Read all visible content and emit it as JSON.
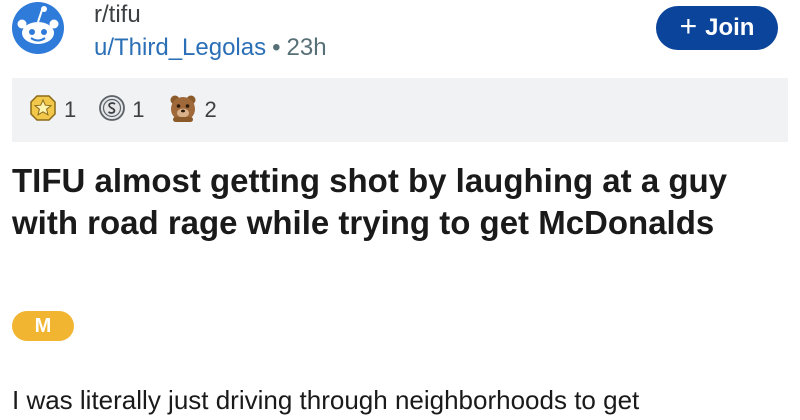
{
  "header": {
    "subreddit": "r/tifu",
    "username": "u/Third_Legolas",
    "separator": "•",
    "age": "23h",
    "join_label": "Join",
    "join_color": "#0a449b"
  },
  "awards": [
    {
      "icon": "star-award-icon",
      "count": "1"
    },
    {
      "icon": "silver-coin-award-icon",
      "count": "1"
    },
    {
      "icon": "bear-award-icon",
      "count": "2"
    }
  ],
  "post": {
    "title": "TIFU almost getting shot by laughing at a guy with road rage while trying to get McDonalds",
    "flair": "M",
    "flair_color": "#f2b531",
    "body_preview": "I was literally just driving through neighborhoods to get"
  }
}
